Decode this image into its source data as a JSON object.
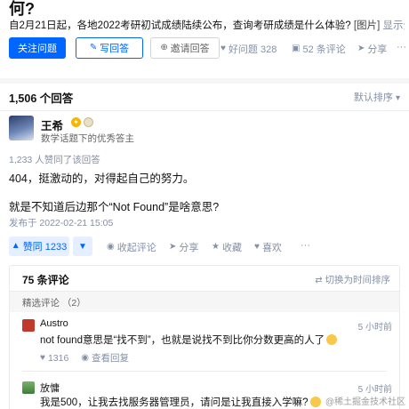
{
  "question": {
    "title": "何?",
    "description": "自2月21日起，各地2022考研初试成绩陆续公布，查询考研成绩是什么体验?",
    "image_tag": "[图片]",
    "show_all": "显示全部"
  },
  "question_actions": {
    "follow": "关注问题",
    "write": "写回答",
    "invite": "邀请回答",
    "good_question": "好问题 328",
    "comments": "52 条评论",
    "share": "分享",
    "more": "···"
  },
  "answers": {
    "count": "1,506 个回答",
    "sort": "默认排序"
  },
  "answer": {
    "author_name": "王希",
    "author_desc": "数学话题下的优秀答主",
    "votes_text": "1,233 人赞同了该回答",
    "paragraphs": [
      "404，挺激动的，对得起自己的努力。",
      "就是不知道后边那个“Not Found”是啥意思?"
    ],
    "publish_time": "发布于 2022-02-21 15:05",
    "actions": {
      "upvote": "赞同 1233",
      "downvote": "▼",
      "collapse_comments": "收起评论",
      "share": "分享",
      "collect": "收藏",
      "like": "喜欢",
      "more": "···"
    }
  },
  "comments": {
    "count": "75 条评论",
    "switch": "切换为时间排序",
    "featured": "精选评论 （2）",
    "items": [
      {
        "name": "Austro",
        "time": "5 小时前",
        "text": "not found意思是“找不到”，也就是说找不到比你分数更高的人了",
        "likes": "1316",
        "view_reply": "查看回复"
      },
      {
        "name": "放慵",
        "time": "5 小时前",
        "text": "我是500，让我去找服务器管理员，请问是让我直接入学嘛?"
      }
    ]
  },
  "watermark": "@稀土掘金技术社区",
  "colors": {
    "brand_blue": "#0066ff",
    "muted": "#8590a6",
    "vote_bg": "#e5efff"
  },
  "icons": {
    "good_question": "thumbs-up-icon",
    "comments": "chat-bubble-icon",
    "share": "share-arrow-icon",
    "sort": "switch-arrows-icon"
  }
}
